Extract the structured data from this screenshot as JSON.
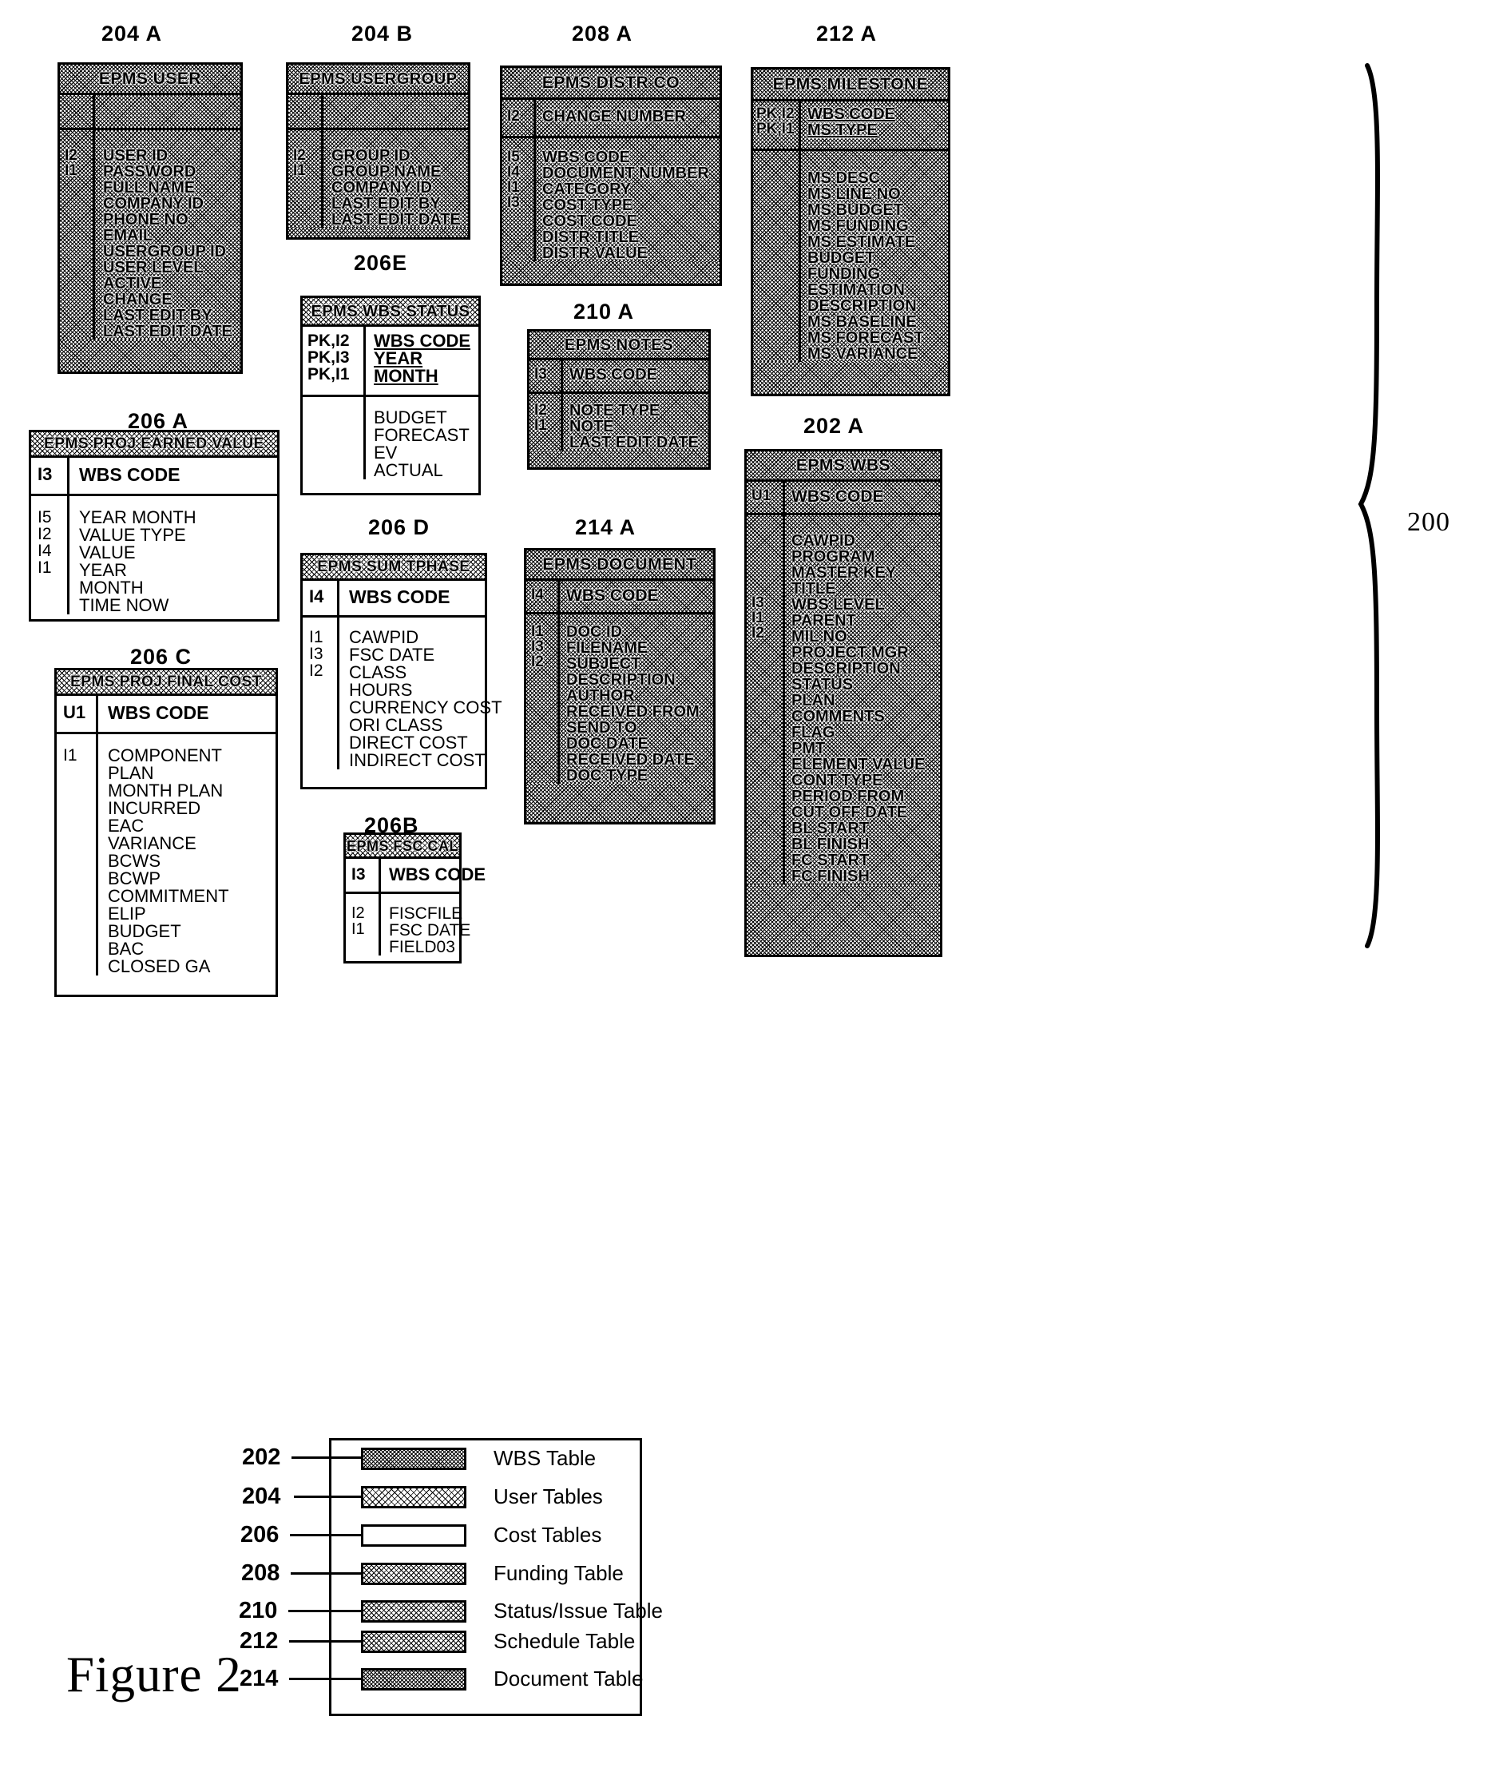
{
  "figure": {
    "label": "Figure 2",
    "overall_ref": "200"
  },
  "entities": [
    {
      "ref": "204 A",
      "title": "EPMS USER",
      "shading": "dense",
      "key_keys": [],
      "key_fields": [],
      "body_keys": [
        "I2",
        "",
        "",
        "I1",
        "",
        "",
        "",
        "",
        "",
        "",
        "",
        ""
      ],
      "body_fields": [
        "USER ID",
        "PASSWORD",
        "FULL NAME",
        "COMPANY ID",
        "PHONE NO",
        "EMAIL",
        "USERGROUP ID",
        "USER LEVEL",
        "ACTIVE",
        "CHANGE",
        "LAST EDIT BY",
        "LAST EDIT DATE"
      ]
    },
    {
      "ref": "204 B",
      "title": "EPMS USERGROUP",
      "shading": "dense",
      "key_keys": [],
      "key_fields": [],
      "body_keys": [
        "I2",
        "",
        "I1",
        "",
        ""
      ],
      "body_fields": [
        "GROUP ID",
        "GROUP NAME",
        "COMPANY ID",
        "LAST EDIT BY",
        "LAST EDIT DATE"
      ]
    },
    {
      "ref": "208 A",
      "title": "EPMS DISTR CO",
      "shading": "dense",
      "key_keys": [
        "I2"
      ],
      "key_fields": [
        "CHANGE NUMBER"
      ],
      "body_keys": [
        "I5",
        "I4",
        "I1",
        "I3",
        "",
        "",
        ""
      ],
      "body_fields": [
        "WBS CODE",
        "DOCUMENT NUMBER",
        "CATEGORY",
        "COST TYPE",
        "COST CODE",
        "DISTR TITLE",
        "DISTR VALUE"
      ]
    },
    {
      "ref": "212 A",
      "title": "EPMS MILESTONE",
      "shading": "dense",
      "key_keys": [
        "PK,I2",
        "PK,I1"
      ],
      "key_fields": [
        "WBS CODE",
        "MS TYPE"
      ],
      "body_keys": [
        "",
        "",
        "",
        "",
        "",
        "",
        "",
        "",
        "",
        "",
        "",
        ""
      ],
      "body_fields": [
        "MS DESC",
        "MS LINE NO",
        "MS BUDGET",
        "MS FUNDING",
        "MS ESTIMATE",
        "BUDGET",
        "FUNDING",
        "ESTIMATION",
        "DESCRIPTION",
        "MS BASELINE",
        "MS FORECAST",
        "MS VARIANCE"
      ]
    },
    {
      "ref": "206E",
      "title": "EPMS WBS STATUS",
      "shading": "none",
      "key_keys": [
        "PK,I2",
        "PK,I3",
        "PK,I1"
      ],
      "key_fields": [
        "WBS CODE",
        "YEAR",
        "MONTH"
      ],
      "body_keys": [
        "",
        "",
        "",
        ""
      ],
      "body_fields": [
        "BUDGET",
        "FORECAST",
        "EV",
        "ACTUAL"
      ]
    },
    {
      "ref": "210 A",
      "title": "EPMS NOTES",
      "shading": "dense",
      "key_keys": [
        "I3"
      ],
      "key_fields": [
        "WBS CODE"
      ],
      "body_keys": [
        "I2",
        "",
        "I1"
      ],
      "body_fields": [
        "NOTE TYPE",
        "NOTE",
        "LAST EDIT DATE"
      ]
    },
    {
      "ref": "206 A",
      "title": "EPMS PROJ EARNED VALUE",
      "shading": "none",
      "key_keys": [
        "I3"
      ],
      "key_fields": [
        "WBS CODE"
      ],
      "body_keys": [
        "I5",
        "I2",
        "",
        "I4",
        "I1",
        ""
      ],
      "body_fields": [
        "YEAR MONTH",
        "VALUE TYPE",
        "VALUE",
        "YEAR",
        "MONTH",
        "TIME NOW"
      ]
    },
    {
      "ref": "206 D",
      "title": "EPMS SUM TPHASE",
      "shading": "none",
      "key_keys": [
        "I4"
      ],
      "key_fields": [
        "WBS CODE"
      ],
      "body_keys": [
        "I1",
        "I3",
        "I2",
        "",
        "",
        "",
        "",
        ""
      ],
      "body_fields": [
        "CAWPID",
        "FSC DATE",
        "CLASS",
        "HOURS",
        "CURRENCY COST",
        "ORI CLASS",
        "DIRECT COST",
        "INDIRECT COST"
      ]
    },
    {
      "ref": "214 A",
      "title": "EPMS DOCUMENT",
      "shading": "dense",
      "key_keys": [
        "I4"
      ],
      "key_fields": [
        "WBS CODE"
      ],
      "body_keys": [
        "I1",
        "I3",
        "I2",
        "",
        "",
        "",
        "",
        "",
        "",
        ""
      ],
      "body_fields": [
        "DOC ID",
        "FILENAME",
        "SUBJECT",
        "DESCRIPTION",
        "AUTHOR",
        "RECEIVED FROM",
        "SEND TO",
        "DOC DATE",
        "RECEIVED DATE",
        "DOC TYPE"
      ]
    },
    {
      "ref": "202 A",
      "title": "EPMS WBS",
      "shading": "dense",
      "key_keys": [
        "U1"
      ],
      "key_fields": [
        "WBS CODE"
      ],
      "body_keys": [
        "",
        "",
        "",
        "I3",
        "I1",
        "I2",
        "",
        "",
        "",
        "",
        "",
        "",
        "",
        "",
        "",
        "",
        "",
        "",
        "",
        "",
        ""
      ],
      "body_fields": [
        "CAWPID",
        "PROGRAM",
        "MASTER KEY",
        "TITLE",
        "WBS LEVEL",
        "PARENT",
        "MIL NO",
        "PROJECT MGR",
        "DESCRIPTION",
        "STATUS",
        "PLAN",
        "COMMENTS",
        "FLAG",
        "PMT",
        "ELEMENT VALUE",
        "CONT TYPE",
        "PERIOD FROM",
        "CUT OFF DATE",
        "BL START",
        "BL FINISH",
        "FC START",
        "FC FINISH"
      ]
    },
    {
      "ref": "206 C",
      "title": "EPMS PROJ FINAL COST",
      "shading": "none",
      "key_keys": [
        "U1"
      ],
      "key_fields": [
        "WBS CODE"
      ],
      "body_keys": [
        "I1",
        "",
        "",
        "",
        "",
        "",
        "",
        "",
        "",
        "",
        "",
        "",
        ""
      ],
      "body_fields": [
        "COMPONENT",
        "PLAN",
        "MONTH PLAN",
        "INCURRED",
        "EAC",
        "VARIANCE",
        "BCWS",
        "BCWP",
        "COMMITMENT",
        "ELIP",
        "BUDGET",
        "BAC",
        "CLOSED GA"
      ]
    },
    {
      "ref": "206B",
      "title": "EPMS FSC CAL",
      "shading": "none",
      "key_keys": [
        "I3"
      ],
      "key_fields": [
        "WBS CODE"
      ],
      "body_keys": [
        "I2",
        "I1",
        ""
      ],
      "body_fields": [
        "FISCFILE",
        "FSC DATE",
        "FIELD03"
      ]
    }
  ],
  "legend": {
    "rows": [
      {
        "num": "202",
        "label": "WBS Table",
        "shading": "dense"
      },
      {
        "num": "204",
        "label": "User Tables",
        "shading": "light"
      },
      {
        "num": "206",
        "label": "Cost Tables",
        "shading": "none"
      },
      {
        "num": "208",
        "label": "Funding Table",
        "shading": "med"
      },
      {
        "num": "210",
        "label": "Status/Issue Table",
        "shading": "med"
      },
      {
        "num": "212",
        "label": "Schedule Table",
        "shading": "med"
      },
      {
        "num": "214",
        "label": "Document Table",
        "shading": "dense"
      }
    ]
  }
}
